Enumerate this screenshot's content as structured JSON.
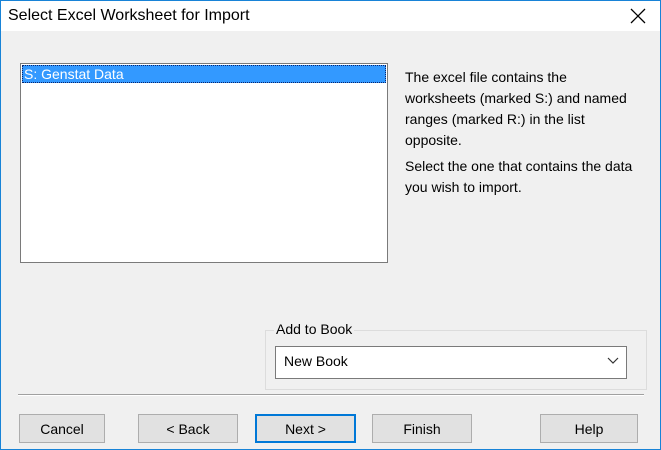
{
  "window": {
    "title": "Select Excel Worksheet for Import"
  },
  "worksheet_list": {
    "items": [
      {
        "label": "S: Genstat Data",
        "selected": true
      }
    ]
  },
  "info": {
    "paragraph1": "The excel file contains the worksheets (marked S:) and named ranges (marked R:) in the list opposite.",
    "paragraph2": "Select the one that contains the data you wish to import."
  },
  "add_to_book": {
    "label": "Add to Book",
    "selected": "New Book"
  },
  "buttons": {
    "cancel": "Cancel",
    "back": "< Back",
    "next": "Next >",
    "finish": "Finish",
    "help": "Help"
  },
  "colors": {
    "accent": "#0078d7",
    "selection": "#3399ff",
    "window_border": "#1883d7",
    "dialog_bg": "#f0f0f0"
  },
  "icons": {
    "close": "close-icon",
    "dropdown": "chevron-down-icon"
  }
}
